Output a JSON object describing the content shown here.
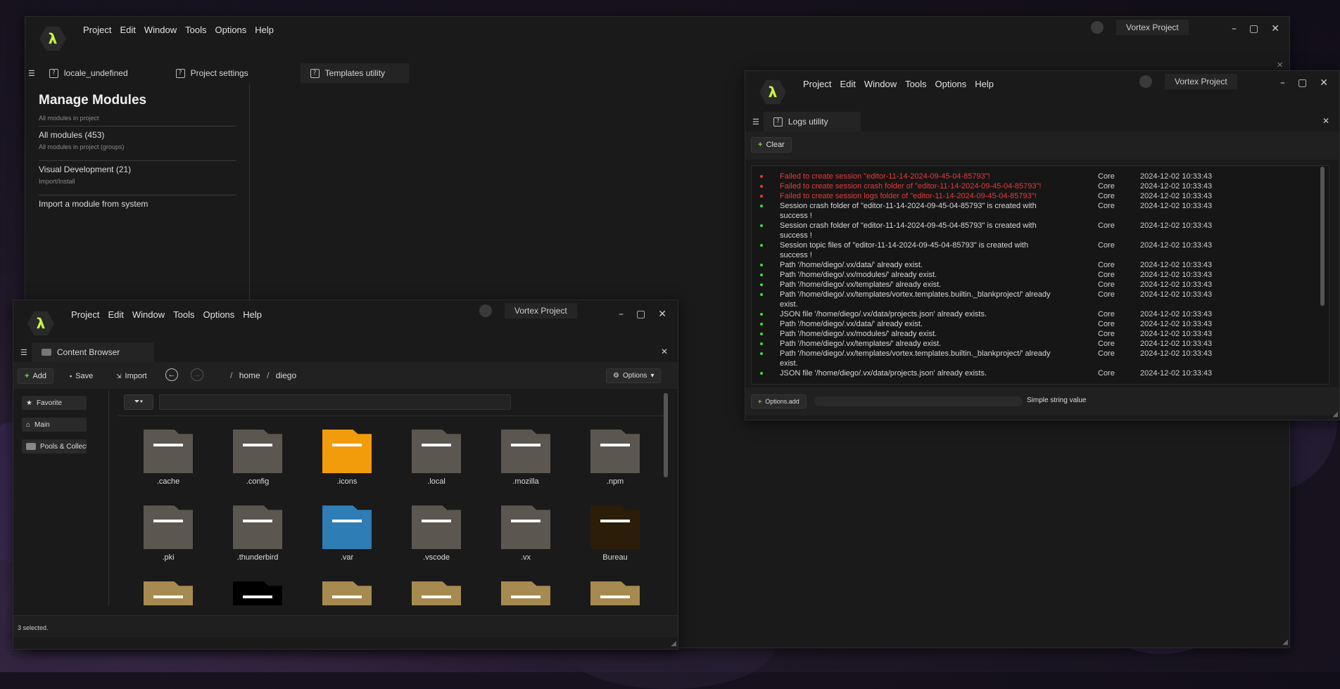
{
  "main_window": {
    "menu": [
      "Project",
      "Edit",
      "Window",
      "Tools",
      "Options",
      "Help"
    ],
    "project_name": "Vortex Project",
    "tabs": [
      {
        "label": "locale_undefined"
      },
      {
        "label": "Project settings"
      },
      {
        "label": "Templates utility"
      }
    ],
    "modules": {
      "title": "Manage Modules",
      "subtitle": "All modules in project",
      "items": [
        {
          "label": "All modules (453)",
          "sub": "All modules in project (groups)"
        },
        {
          "label": "Visual Development (21)",
          "sub": "Import/Install"
        },
        {
          "label": "Import a module from system",
          "sub": ""
        }
      ]
    }
  },
  "logs_window": {
    "menu": [
      "Project",
      "Edit",
      "Window",
      "Tools",
      "Options",
      "Help"
    ],
    "project_name": "Vortex Project",
    "tab_label": "Logs utility",
    "clear_label": "Clear",
    "error_color": "#e53a3a",
    "success_color": "#3ddc3d",
    "entries": [
      {
        "level": "error",
        "message": "Failed to create session \"editor-11-14-2024-09-45-04-85793\"!",
        "source": "Core",
        "time": "2024-12-02 10:33:43"
      },
      {
        "level": "error",
        "message": "Failed to create session crash folder of \"editor-11-14-2024-09-45-04-85793\"!",
        "source": "Core",
        "time": "2024-12-02 10:33:43"
      },
      {
        "level": "error",
        "message": "Failed to create session logs folder of \"editor-11-14-2024-09-45-04-85793\"!",
        "source": "Core",
        "time": "2024-12-02 10:33:43"
      },
      {
        "level": "ok",
        "message": "Session crash folder of \"editor-11-14-2024-09-45-04-85793\" is created with success !",
        "source": "Core",
        "time": "2024-12-02 10:33:43"
      },
      {
        "level": "ok",
        "message": "Session crash folder of \"editor-11-14-2024-09-45-04-85793\" is created with success !",
        "source": "Core",
        "time": "2024-12-02 10:33:43"
      },
      {
        "level": "ok",
        "message": "Session topic files of \"editor-11-14-2024-09-45-04-85793\" is created with success !",
        "source": "Core",
        "time": "2024-12-02 10:33:43"
      },
      {
        "level": "ok",
        "message": "Path '/home/diego/.vx/data/' already exist.",
        "source": "Core",
        "time": "2024-12-02 10:33:43"
      },
      {
        "level": "ok",
        "message": "Path '/home/diego/.vx/modules/' already exist.",
        "source": "Core",
        "time": "2024-12-02 10:33:43"
      },
      {
        "level": "ok",
        "message": "Path '/home/diego/.vx/templates/' already exist.",
        "source": "Core",
        "time": "2024-12-02 10:33:43"
      },
      {
        "level": "ok",
        "message": "Path '/home/diego/.vx/templates/vortex.templates.builtin._blankproject/' already exist.",
        "source": "Core",
        "time": "2024-12-02 10:33:43"
      },
      {
        "level": "ok",
        "message": "JSON file '/home/diego/.vx/data/projects.json' already exists.",
        "source": "Core",
        "time": "2024-12-02 10:33:43"
      },
      {
        "level": "ok",
        "message": "Path '/home/diego/.vx/data/' already exist.",
        "source": "Core",
        "time": "2024-12-02 10:33:43"
      },
      {
        "level": "ok",
        "message": "Path '/home/diego/.vx/modules/' already exist.",
        "source": "Core",
        "time": "2024-12-02 10:33:43"
      },
      {
        "level": "ok",
        "message": "Path '/home/diego/.vx/templates/' already exist.",
        "source": "Core",
        "time": "2024-12-02 10:33:43"
      },
      {
        "level": "ok",
        "message": "Path '/home/diego/.vx/templates/vortex.templates.builtin._blankproject/' already exist.",
        "source": "Core",
        "time": "2024-12-02 10:33:43"
      },
      {
        "level": "ok",
        "message": "JSON file '/home/diego/.vx/data/projects.json' already exists.",
        "source": "Core",
        "time": "2024-12-02 10:33:43"
      }
    ],
    "options_add_label": "Options.add",
    "string_value_label": "Simple string value"
  },
  "content_window": {
    "menu": [
      "Project",
      "Edit",
      "Window",
      "Tools",
      "Options",
      "Help"
    ],
    "project_name": "Vortex Project",
    "tab_label": "Content Browser",
    "toolbar": {
      "add": "Add",
      "save": "Save",
      "import": "Import",
      "options": "Options"
    },
    "breadcrumb": [
      "home",
      "diego"
    ],
    "sidebar": [
      "Favorite",
      "Main",
      "Pools & Collections"
    ],
    "folders": [
      {
        "name": ".cache",
        "color": "#5b5650"
      },
      {
        "name": ".config",
        "color": "#5b5650"
      },
      {
        "name": ".icons",
        "color": "#f39c0b"
      },
      {
        "name": ".local",
        "color": "#5b5650"
      },
      {
        "name": ".mozilla",
        "color": "#5b5650"
      },
      {
        "name": ".npm",
        "color": "#5b5650"
      },
      {
        "name": ".pki",
        "color": "#5b5650"
      },
      {
        "name": ".thunderbird",
        "color": "#5b5650"
      },
      {
        "name": ".var",
        "color": "#2e7db5"
      },
      {
        "name": ".vscode",
        "color": "#5b5650"
      },
      {
        "name": ".vx",
        "color": "#5b5650"
      },
      {
        "name": "Bureau",
        "color": "#2b1d08"
      },
      {
        "name": "",
        "color": "#a78a4f"
      },
      {
        "name": "",
        "color": "#000000"
      },
      {
        "name": "",
        "color": "#a78a4f"
      },
      {
        "name": "",
        "color": "#a78a4f"
      },
      {
        "name": "",
        "color": "#a78a4f"
      },
      {
        "name": "",
        "color": "#a78a4f"
      }
    ],
    "status": "3 selected."
  }
}
